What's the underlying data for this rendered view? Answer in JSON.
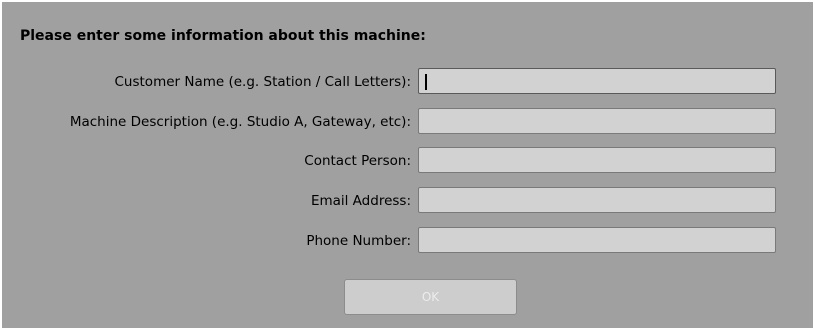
{
  "heading": "Please enter some information about this machine:",
  "form": {
    "fields": [
      {
        "label": "Customer Name (e.g. Station / Call Letters):",
        "value": ""
      },
      {
        "label": "Machine Description (e.g. Studio A, Gateway, etc):",
        "value": ""
      },
      {
        "label": "Contact Person:",
        "value": ""
      },
      {
        "label": "Email Address:",
        "value": ""
      },
      {
        "label": "Phone Number:",
        "value": ""
      }
    ]
  },
  "ok_button": {
    "label": "OK",
    "enabled": false
  },
  "colors": {
    "dialog_background": "#a0a0a0",
    "field_background": "#d2d2d2",
    "button_text_disabled": "#ececec"
  }
}
